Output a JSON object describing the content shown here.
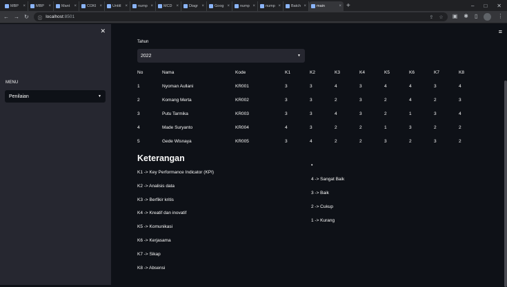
{
  "browser": {
    "tabs": [
      {
        "label": "MBP"
      },
      {
        "label": "MBP"
      },
      {
        "label": "Mant"
      },
      {
        "label": "COKI"
      },
      {
        "label": "Untitl"
      },
      {
        "label": "nump"
      },
      {
        "label": "MCD"
      },
      {
        "label": "Diagr"
      },
      {
        "label": "Goog"
      },
      {
        "label": "nump"
      },
      {
        "label": "nump"
      },
      {
        "label": "Batch"
      },
      {
        "label": "main"
      }
    ],
    "new_tab": "+",
    "url_host": "localhost",
    "url_port": ":8501"
  },
  "sidebar": {
    "close": "✕",
    "menu_label": "MENU",
    "select_value": "Penilaian"
  },
  "main": {
    "hamburger": "≡",
    "tahun_label": "Tahun",
    "tahun_value": "2022",
    "table": {
      "headers": [
        "No",
        "Nama",
        "Kode",
        "K1",
        "K2",
        "K3",
        "K4",
        "K5",
        "K6",
        "K7",
        "K8"
      ],
      "rows": [
        [
          "1",
          "Nyoman Aullani",
          "KR001",
          "3",
          "3",
          "4",
          "3",
          "4",
          "4",
          "3",
          "4"
        ],
        [
          "2",
          "Komang Merta",
          "KR002",
          "3",
          "3",
          "2",
          "3",
          "2",
          "4",
          "2",
          "3"
        ],
        [
          "3",
          "Putu Tarmika",
          "KR003",
          "3",
          "3",
          "4",
          "3",
          "2",
          "1",
          "3",
          "4"
        ],
        [
          "4",
          "Made Suryanto",
          "KR004",
          "4",
          "3",
          "2",
          "2",
          "1",
          "3",
          "2",
          "2"
        ],
        [
          "5",
          "Gede Wisnaya",
          "KR005",
          "3",
          "4",
          "2",
          "2",
          "3",
          "2",
          "3",
          "2"
        ]
      ]
    },
    "keterangan_title": "Keterangan",
    "keterangan": [
      "K1 -> Key Performance Indicator (KPI)",
      "K2 -> Analisis data",
      "K3 -> Berfikir kritis",
      "K4 -> Kreatif dan inovatif",
      "K5 -> Komunikasi",
      "K6 -> Kerjasama",
      "K7 -> Sikap",
      "K8 -> Absensi"
    ],
    "bullet": "•",
    "skala": [
      "4 -> Sangat Baik",
      "3 -> Baik",
      "2 -> Cukup",
      "1 -> Kurang"
    ]
  }
}
